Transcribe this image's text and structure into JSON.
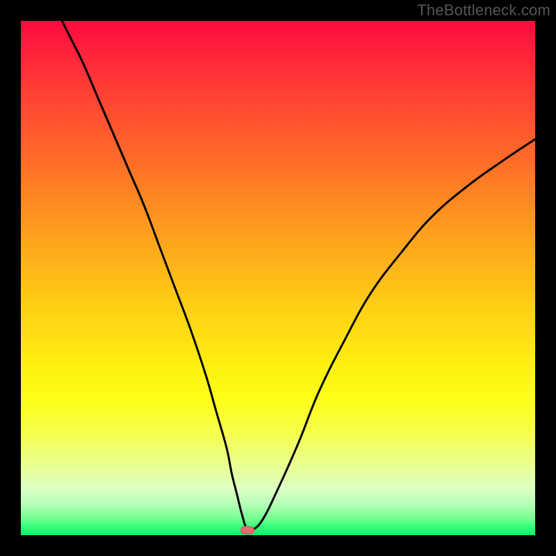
{
  "watermark": "TheBottleneck.com",
  "colors": {
    "frame_bg": "#000000",
    "curve_stroke": "#000000",
    "marker_fill": "#e07070"
  },
  "chart_data": {
    "type": "line",
    "title": "",
    "xlabel": "",
    "ylabel": "",
    "xlim": [
      0,
      100
    ],
    "ylim": [
      0,
      100
    ],
    "grid": false,
    "legend": false,
    "annotations": [],
    "marker": {
      "x": 44,
      "y": 1,
      "shape": "pill"
    },
    "series": [
      {
        "name": "bottleneck-curve",
        "x": [
          8,
          10,
          12,
          15,
          18,
          21,
          24,
          27,
          30,
          33,
          36,
          38,
          40,
          41,
          42,
          43,
          44,
          45,
          47,
          50,
          54,
          58,
          63,
          68,
          74,
          80,
          87,
          94,
          100
        ],
        "y": [
          100,
          96,
          92,
          85,
          78,
          71,
          64,
          56,
          48,
          40,
          31,
          24,
          17,
          12,
          8,
          4,
          1,
          1,
          3,
          9,
          18,
          28,
          38,
          47,
          55,
          62,
          68,
          73,
          77
        ]
      }
    ]
  }
}
